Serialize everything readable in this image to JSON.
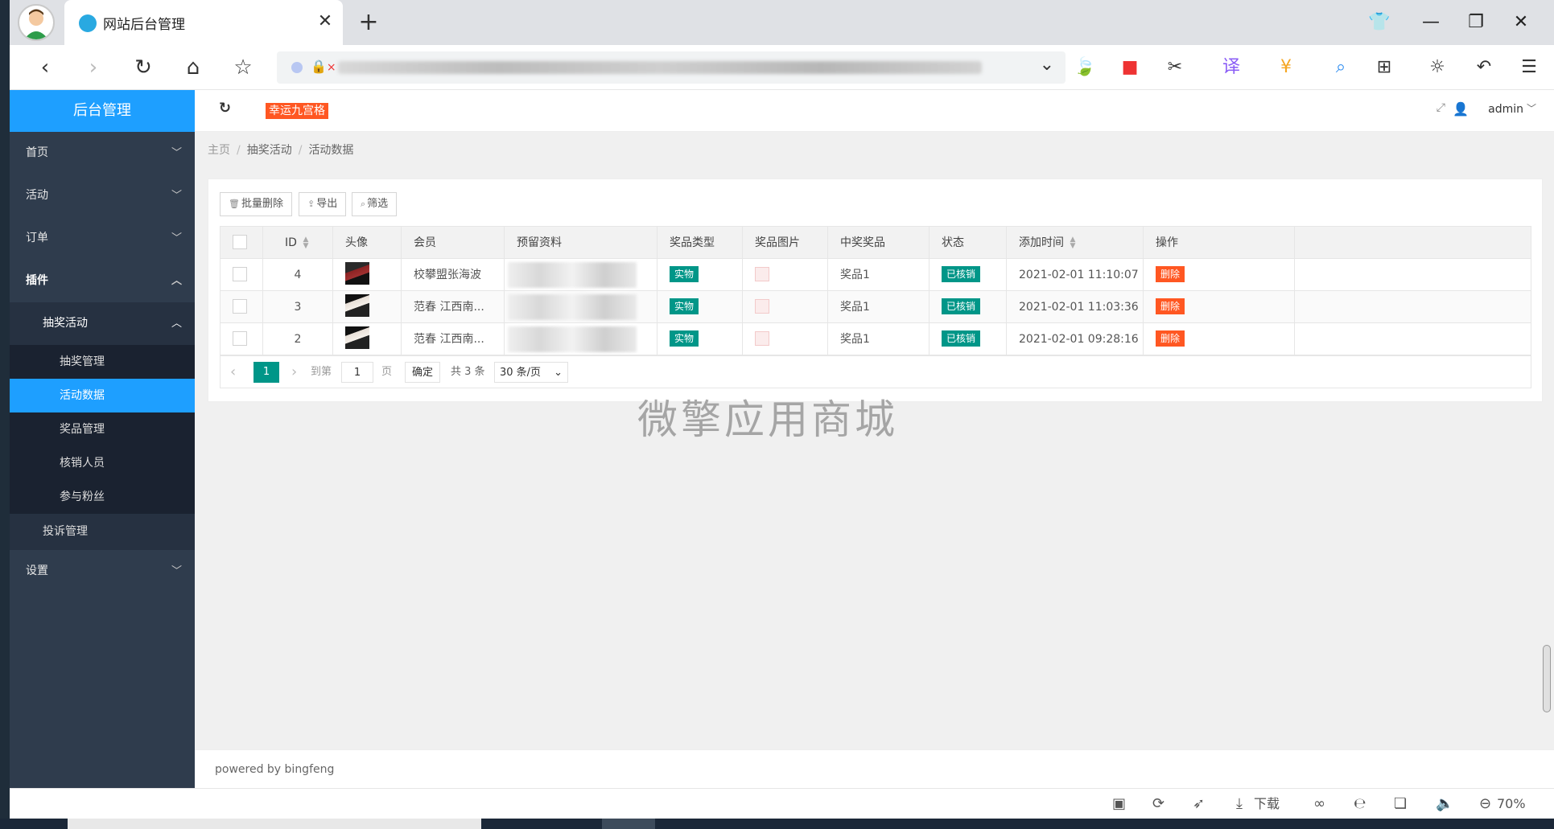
{
  "browser": {
    "tab_title": "网站后台管理",
    "download_label": "下载",
    "zoom": "70%"
  },
  "app": {
    "logo": "后台管理",
    "game_badge": "幸运九宫格",
    "user": "admin",
    "footer": "powered by bingfeng",
    "watermark": "微擎应用商城"
  },
  "sidebar": {
    "items": [
      {
        "label": "首页"
      },
      {
        "label": "活动"
      },
      {
        "label": "订单"
      },
      {
        "label": "插件"
      },
      {
        "label": "抽奖活动"
      },
      {
        "label": "抽奖管理"
      },
      {
        "label": "活动数据"
      },
      {
        "label": "奖品管理"
      },
      {
        "label": "核销人员"
      },
      {
        "label": "参与粉丝"
      },
      {
        "label": "投诉管理"
      },
      {
        "label": "设置"
      }
    ]
  },
  "breadcrumb": [
    "主页",
    "抽奖活动",
    "活动数据"
  ],
  "toolbar": {
    "batch_delete": "批量删除",
    "export": "导出",
    "filter": "筛选"
  },
  "table": {
    "headers": [
      "ID",
      "头像",
      "会员",
      "预留资料",
      "奖品类型",
      "奖品图片",
      "中奖奖品",
      "状态",
      "添加时间",
      "操作"
    ],
    "rows": [
      {
        "id": "4",
        "member": "校攀盟张海波",
        "type": "实物",
        "prize": "奖品1",
        "status": "已核销",
        "time": "2021-02-01 11:10:07",
        "action": "删除"
      },
      {
        "id": "3",
        "member": "范春 江西南...",
        "type": "实物",
        "prize": "奖品1",
        "status": "已核销",
        "time": "2021-02-01 11:03:36",
        "action": "删除"
      },
      {
        "id": "2",
        "member": "范春 江西南...",
        "type": "实物",
        "prize": "奖品1",
        "status": "已核销",
        "time": "2021-02-01 09:28:16",
        "action": "删除"
      }
    ]
  },
  "pager": {
    "current": "1",
    "goto_label": "到第",
    "page_input": "1",
    "page_unit": "页",
    "confirm": "确定",
    "total": "共 3 条",
    "page_size": "30 条/页"
  },
  "colors": {
    "accent": "#1e9fff",
    "sidebar": "#2f3c4d",
    "green_tag": "#009688",
    "red_tag": "#ff5722"
  }
}
